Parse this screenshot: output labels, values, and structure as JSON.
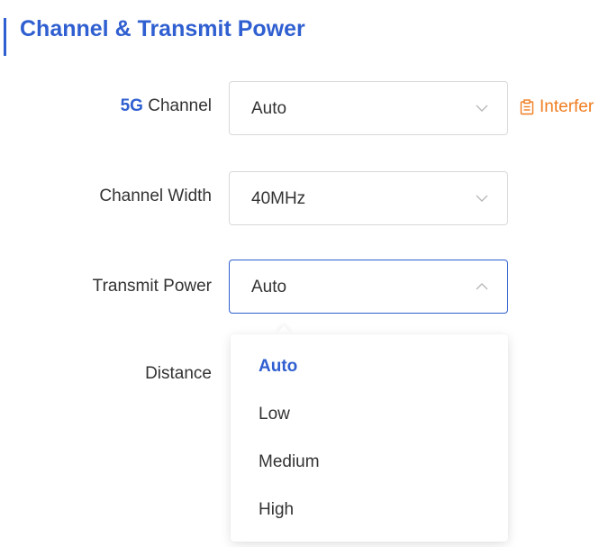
{
  "section": {
    "title": "Channel & Transmit Power"
  },
  "channel": {
    "label_prefix": "5G",
    "label_suffix": " Channel",
    "value": "Auto",
    "interference_label": "Interfer"
  },
  "channel_width": {
    "label": "Channel Width",
    "value": "40MHz"
  },
  "transmit_power": {
    "label": "Transmit Power",
    "value": "Auto",
    "options": [
      "Auto",
      "Low",
      "Medium",
      "High"
    ],
    "selected_option": "Auto"
  },
  "distance": {
    "label": "Distance"
  },
  "colors": {
    "accent": "#2f5fd0",
    "warning": "#f07d20",
    "text": "#333333",
    "border": "#d9d9d9"
  },
  "icons": {
    "select_closed": "chevron-down-icon",
    "select_open": "chevron-up-icon",
    "interference": "clipboard-icon"
  }
}
